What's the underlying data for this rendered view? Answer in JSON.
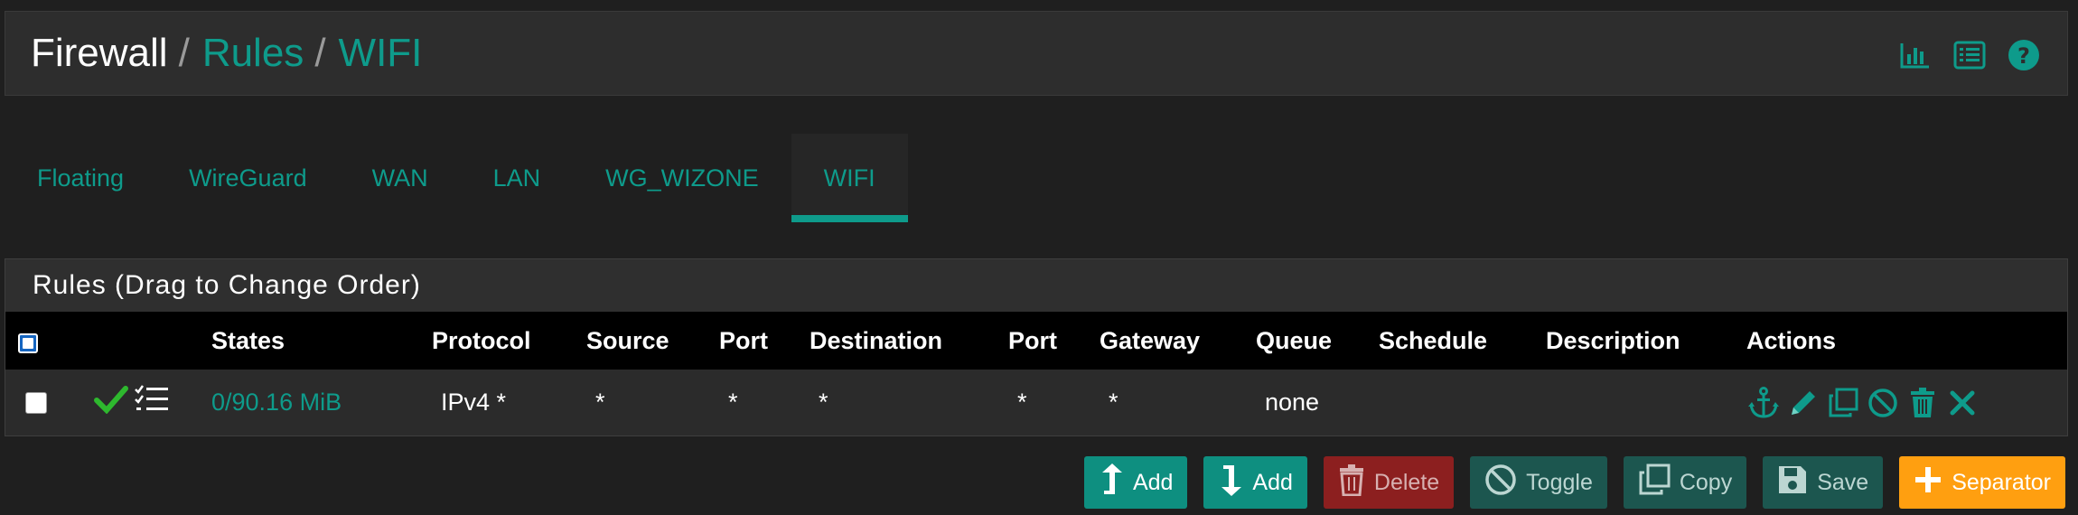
{
  "breadcrumb": {
    "items": [
      "Firewall",
      "Rules",
      "WIFI"
    ],
    "separator": "/"
  },
  "header_icons": [
    "chart-icon",
    "list-icon",
    "help-icon"
  ],
  "tabs": [
    {
      "label": "Floating",
      "active": false
    },
    {
      "label": "WireGuard",
      "active": false
    },
    {
      "label": "WAN",
      "active": false
    },
    {
      "label": "LAN",
      "active": false
    },
    {
      "label": "WG_WIZONE",
      "active": false
    },
    {
      "label": "WIFI",
      "active": true
    }
  ],
  "panel": {
    "title": "Rules (Drag to Change Order)",
    "columns": [
      "States",
      "Protocol",
      "Source",
      "Port",
      "Destination",
      "Port",
      "Gateway",
      "Queue",
      "Schedule",
      "Description",
      "Actions"
    ],
    "rows": [
      {
        "states": "0/90.16 MiB",
        "protocol": "IPv4 *",
        "source": "*",
        "source_port": "*",
        "destination": "*",
        "destination_port": "*",
        "gateway": "*",
        "queue": "none",
        "schedule": "",
        "description": ""
      }
    ]
  },
  "buttons": {
    "add_top": "Add",
    "add_bottom": "Add",
    "delete": "Delete",
    "toggle": "Toggle",
    "copy": "Copy",
    "save": "Save",
    "separator": "Separator"
  },
  "colors": {
    "accent": "#0e9b8b",
    "background": "#1f1f1f",
    "panel": "#2b2b2b",
    "delete": "#8c1f1f",
    "separator": "#ff9f10",
    "pass_check": "#2eb82e"
  }
}
